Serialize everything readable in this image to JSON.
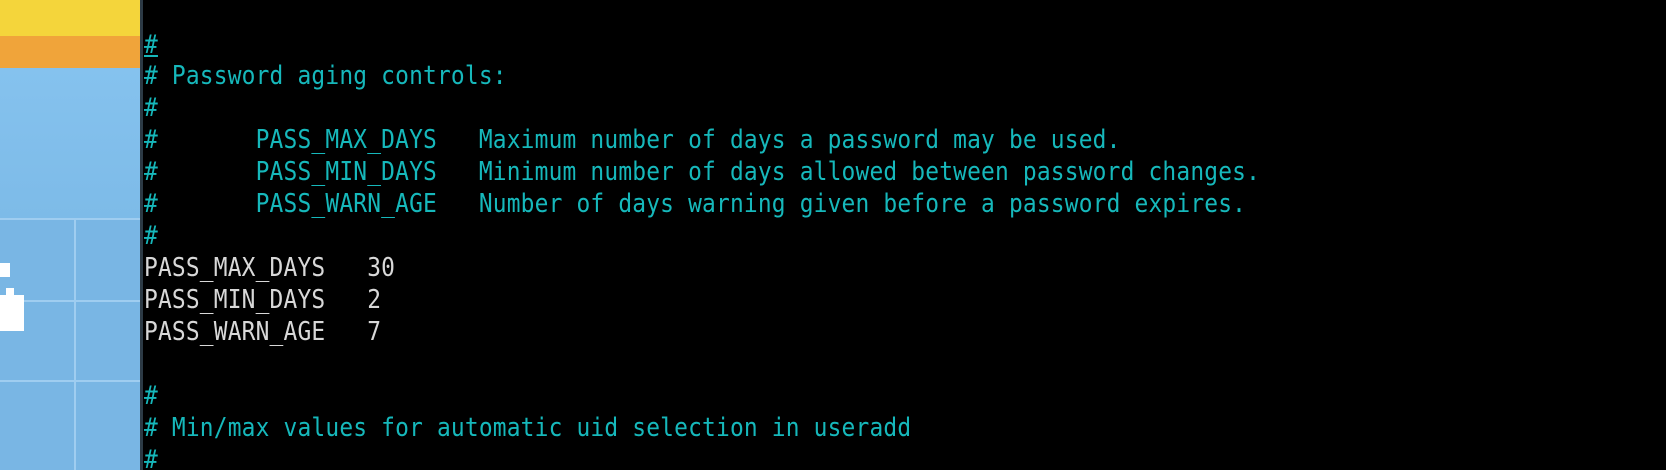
{
  "colors": {
    "comment": "#16b8bb",
    "setting": "#d8d8d8",
    "background": "#000000",
    "desktop_blue": "#7fbde9",
    "desktop_yellow": "#f4d53b",
    "desktop_orange": "#f0a43a"
  },
  "terminal": {
    "lines": [
      {
        "text": "#",
        "kind": "comment"
      },
      {
        "text": "# Password aging controls:",
        "kind": "comment"
      },
      {
        "text": "#",
        "kind": "comment"
      },
      {
        "text": "#       PASS_MAX_DAYS   Maximum number of days a password may be used.",
        "kind": "comment"
      },
      {
        "text": "#       PASS_MIN_DAYS   Minimum number of days allowed between password changes.",
        "kind": "comment"
      },
      {
        "text": "#       PASS_WARN_AGE   Number of days warning given before a password expires.",
        "kind": "comment"
      },
      {
        "text": "#",
        "kind": "comment"
      },
      {
        "text": "PASS_MAX_DAYS   30",
        "kind": "setting"
      },
      {
        "text": "PASS_MIN_DAYS   2",
        "kind": "setting"
      },
      {
        "text": "PASS_WARN_AGE   7",
        "kind": "setting"
      },
      {
        "text": "",
        "kind": "blank"
      },
      {
        "text": "#",
        "kind": "comment"
      },
      {
        "text": "# Min/max values for automatic uid selection in useradd",
        "kind": "comment"
      },
      {
        "text": "#",
        "kind": "comment"
      }
    ]
  }
}
